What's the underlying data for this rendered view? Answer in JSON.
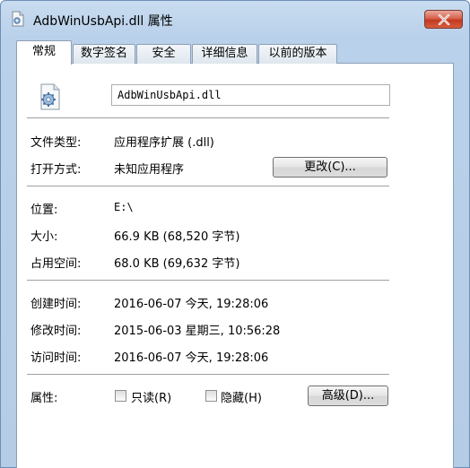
{
  "window": {
    "title": "AdbWinUsbApi.dll 属性",
    "close_icon": "close-icon"
  },
  "tabs": [
    {
      "label": "常规",
      "active": true
    },
    {
      "label": "数字签名",
      "active": false
    },
    {
      "label": "安全",
      "active": false
    },
    {
      "label": "详细信息",
      "active": false
    },
    {
      "label": "以前的版本",
      "active": false
    }
  ],
  "general": {
    "filename": "AdbWinUsbApi.dll",
    "file_type_label": "文件类型:",
    "file_type_value": "应用程序扩展 (.dll)",
    "open_with_label": "打开方式:",
    "open_with_value": "未知应用程序",
    "change_button": "更改(C)...",
    "location_label": "位置:",
    "location_value": "E:\\",
    "size_label": "大小:",
    "size_value": "66.9 KB (68,520 字节)",
    "size_on_disk_label": "占用空间:",
    "size_on_disk_value": "68.0 KB (69,632 字节)",
    "created_label": "创建时间:",
    "created_value": "2016-06-07 今天, 19:28:06",
    "modified_label": "修改时间:",
    "modified_value": "2015-06-03 星期三, 10:56:28",
    "accessed_label": "访问时间:",
    "accessed_value": "2016-06-07 今天, 19:28:06",
    "attributes_label": "属性:",
    "readonly_label": "只读(R)",
    "readonly_checked": false,
    "hidden_label": "隐藏(H)",
    "hidden_checked": false,
    "advanced_button": "高级(D)..."
  },
  "colors": {
    "frame": "#b9d1ea",
    "close_button": "#c94a33"
  }
}
